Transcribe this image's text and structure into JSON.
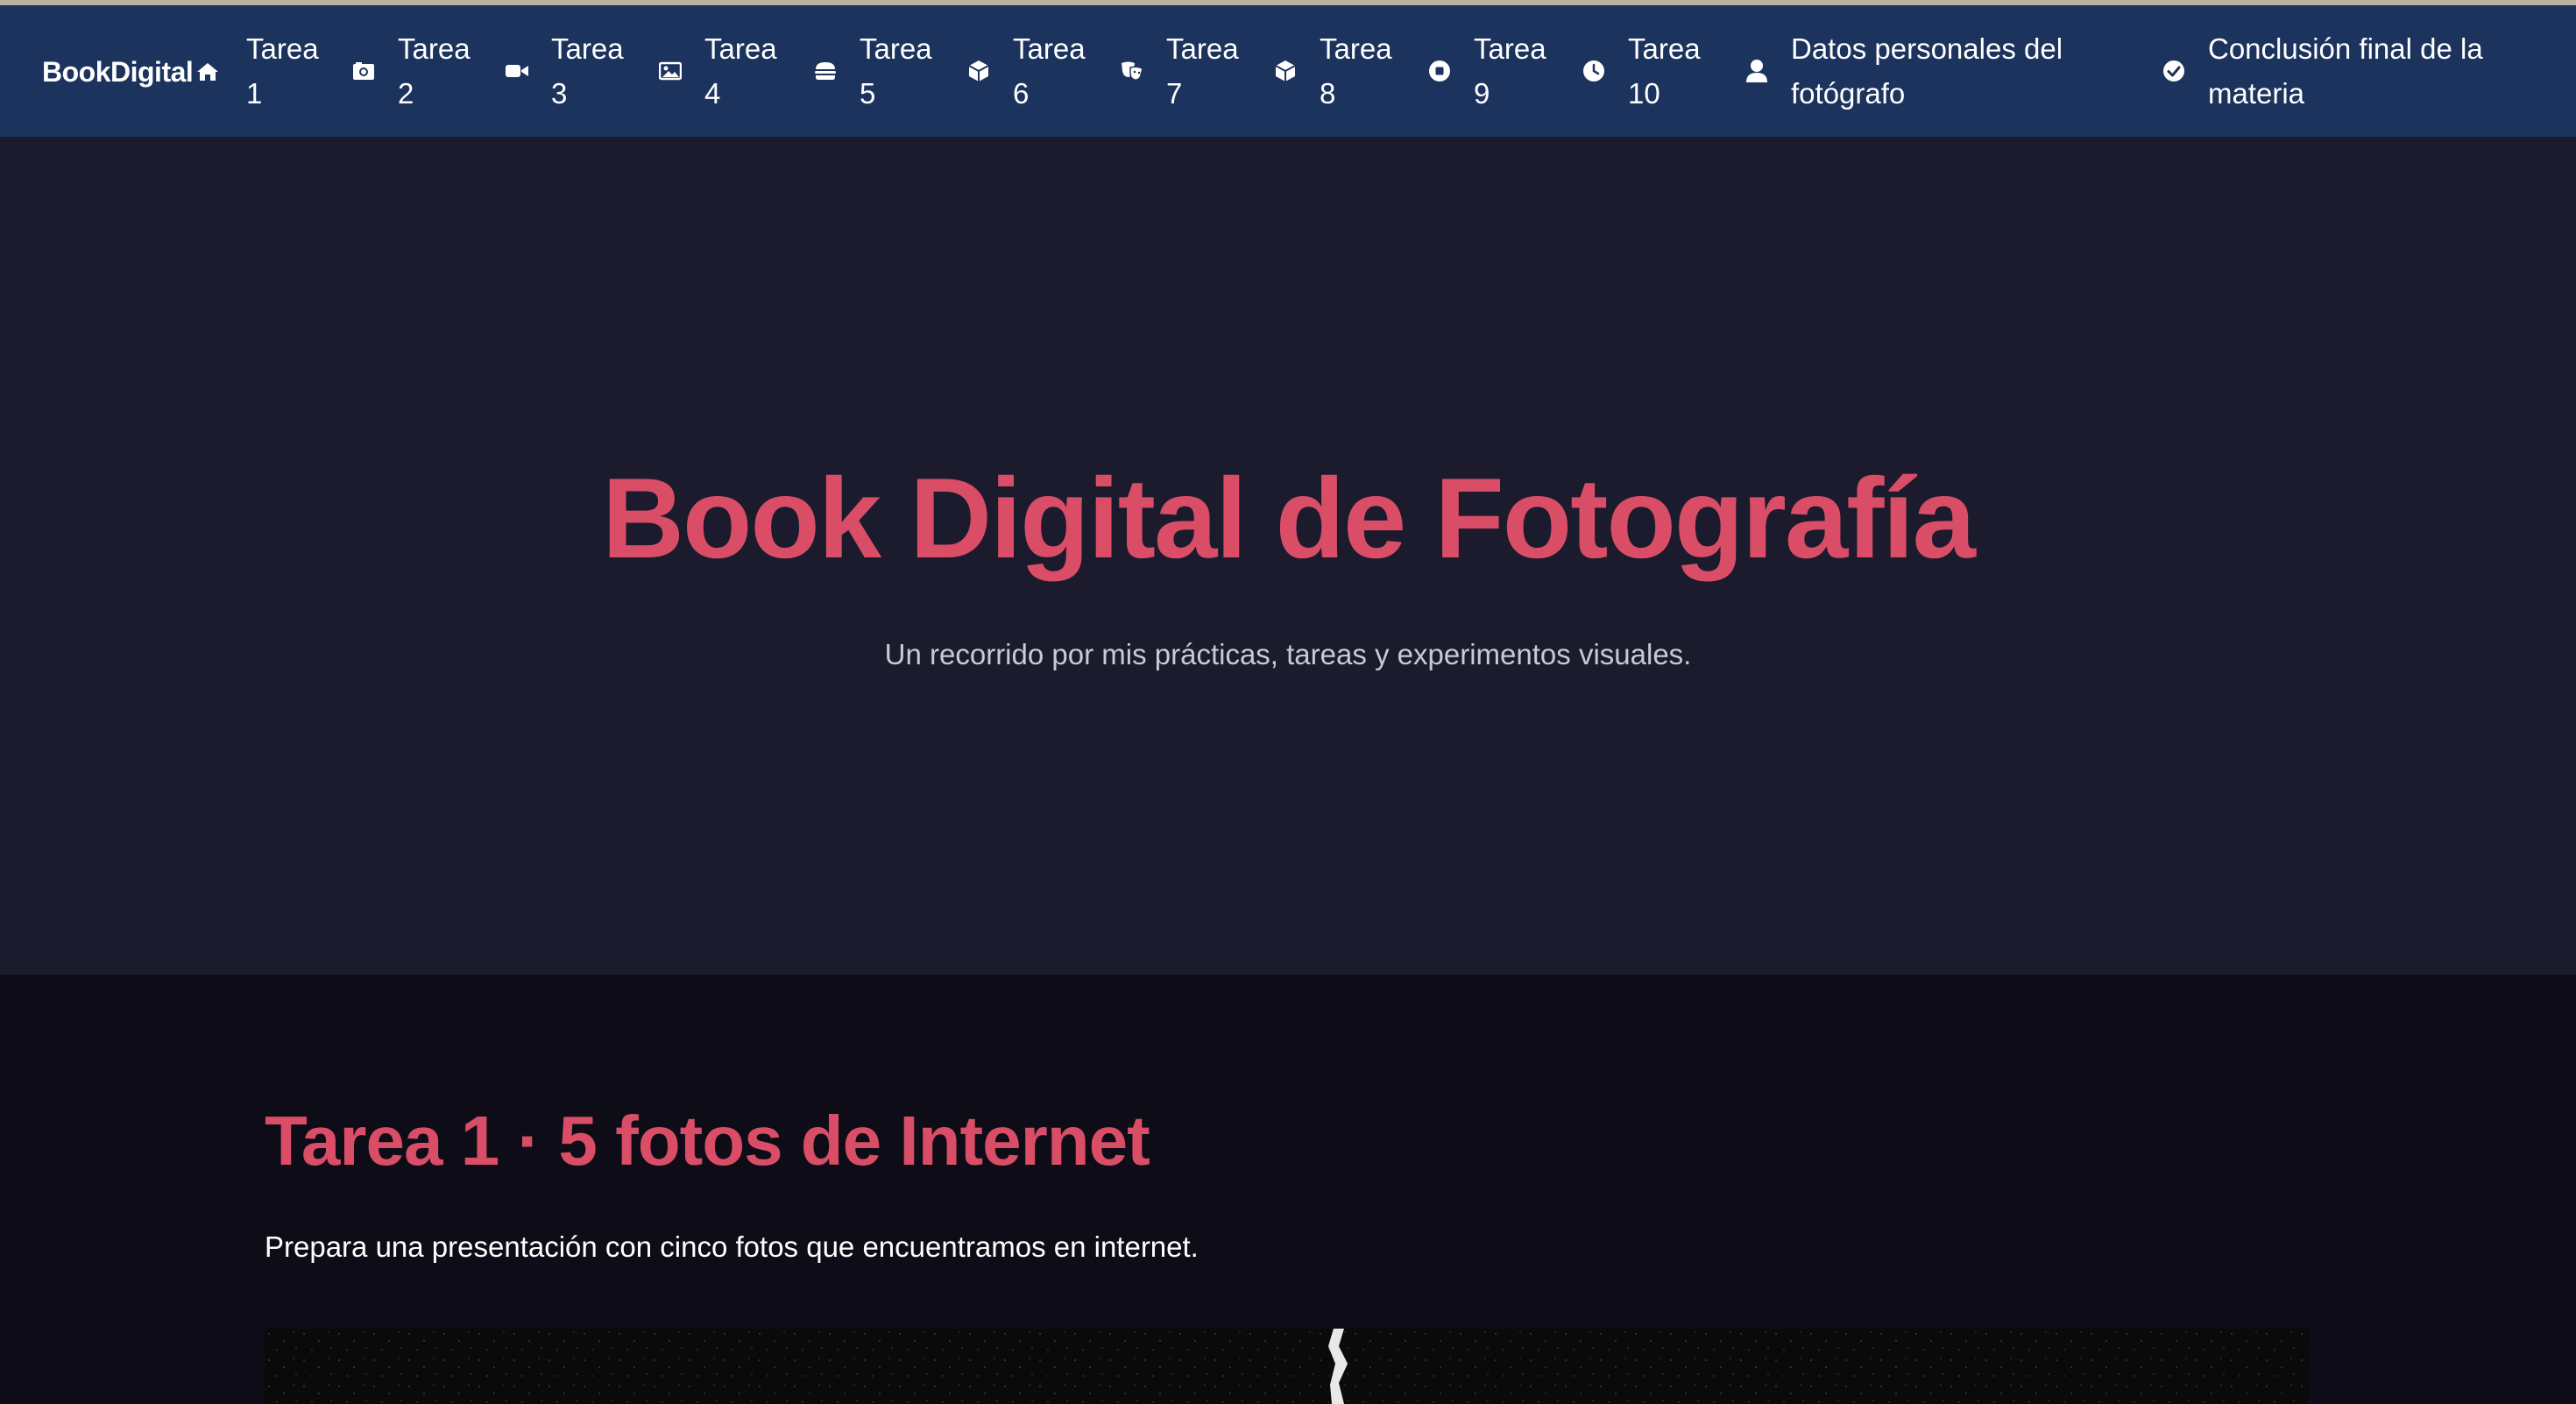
{
  "nav": {
    "brand": "BookDigital",
    "items": [
      {
        "label": "Tarea\n1",
        "icon": "home-icon"
      },
      {
        "label": "Tarea\n2",
        "icon": "camera-icon"
      },
      {
        "label": "Tarea\n3",
        "icon": "video-icon"
      },
      {
        "label": "Tarea\n4",
        "icon": "image-icon"
      },
      {
        "label": "Tarea\n5",
        "icon": "burger-icon"
      },
      {
        "label": "Tarea\n6",
        "icon": "cube-icon"
      },
      {
        "label": "Tarea\n7",
        "icon": "masks-icon"
      },
      {
        "label": "Tarea\n8",
        "icon": "cube-icon"
      },
      {
        "label": "Tarea\n9",
        "icon": "stop-circle-icon"
      },
      {
        "label": "Tarea\n10",
        "icon": "clock-icon"
      },
      {
        "label": "Datos personales del\nfotógrafo",
        "icon": "user-icon"
      },
      {
        "label": "Conclusión final de la\nmateria",
        "icon": "check-circle-icon"
      }
    ]
  },
  "hero": {
    "title": "Book Digital de Fotografía",
    "subtitle": "Un recorrido por mis prácticas, tareas y experimentos visuales."
  },
  "section1": {
    "title": "Tarea 1 · 5 fotos de Internet",
    "description": "Prepara una presentación con cinco fotos que encuentramos en internet."
  },
  "colors": {
    "navbar": "#1c335e",
    "hero_bg": "#1b1b2d",
    "section_bg": "#0e0d17",
    "accent": "#d94d67"
  }
}
